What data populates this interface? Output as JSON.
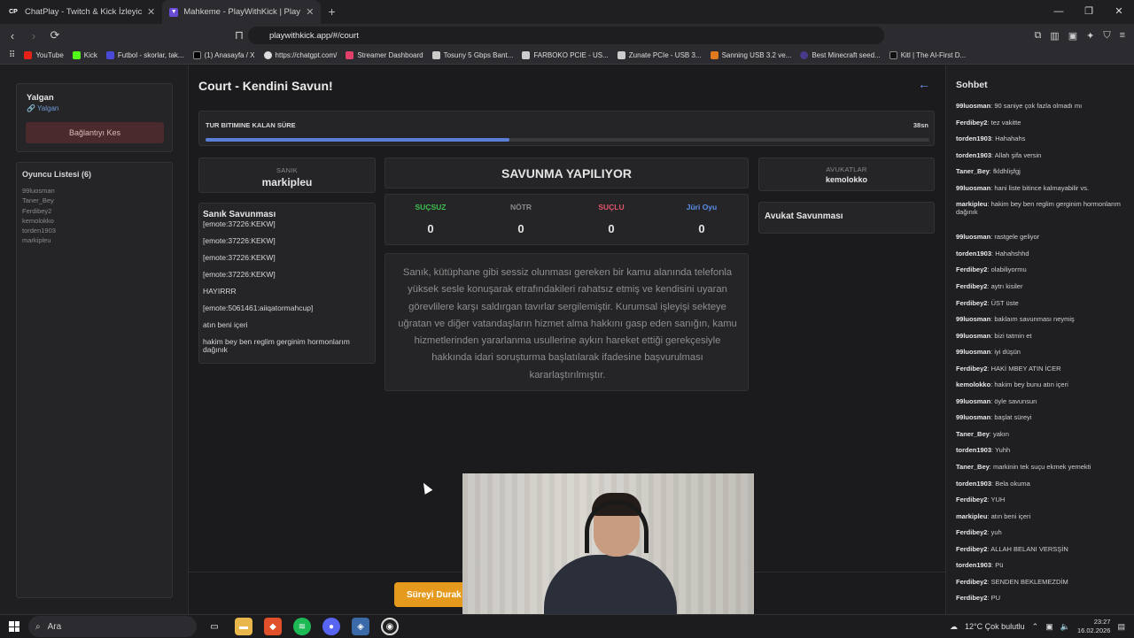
{
  "browser": {
    "tabs": [
      {
        "icon": "CP",
        "title": "ChatPlay - Twitch & Kick İzleyici Etkile",
        "active": false
      },
      {
        "icon": "shield-icon",
        "title": "Mahkeme - PlayWithKick | PlayW",
        "active": true
      }
    ],
    "new_tab": "+",
    "url": "playwithkick.app/#/court",
    "bookmarks": [
      "YouTube",
      "Kick",
      "Futbol - skorlar, tak...",
      "(1) Anasayfa / X",
      "https://chatgpt.com/",
      "Streamer Dashboard",
      "Tosuny 5 Gbps Bant...",
      "FARBOKO PCIE - US...",
      "Zunate PCIe - USB 3...",
      "Sanning USB 3.2 ve...",
      "Best Minecraft seed...",
      "Kitl | The AI-First D..."
    ]
  },
  "left_panel": {
    "user_name": "Yalgan",
    "user_link": "Yalgan",
    "disconnect_label": "Bağlantıyı Kes",
    "player_list_title": "Oyuncu Listesi (6)",
    "players": [
      "99luosman",
      "Taner_Bey",
      "Ferdibey2",
      "kemolokko",
      "torden1903",
      "markipleu"
    ]
  },
  "main": {
    "title": "Court - Kendini Savun!",
    "timer_label": "TUR BITIMINE KALAN SÜRE",
    "timer_value": "38sn",
    "timer_progress": 0.42,
    "defendant_caption": "SANIK",
    "defendant_name": "markipleu",
    "defense_title": "Sanık Savunması",
    "defense_lines": [
      "[emote:37226:KEKW]",
      "[emote:37226:KEKW]",
      "[emote:37226:KEKW]",
      "[emote:37226:KEKW]",
      "HAYIRRR",
      "[emote:5061461:aiiqatormahcup]",
      "atın beni içeri",
      "hakim bey ben reglim gerginim hormonlarım dağınık"
    ],
    "status": "SAVUNMA YAPILIYOR",
    "votes": [
      {
        "label": "SUÇSUZ",
        "value": "0",
        "color": "#3fbf4f"
      },
      {
        "label": "NÖTR",
        "value": "0",
        "color": "#8a8a8a"
      },
      {
        "label": "SUÇLU",
        "value": "0",
        "color": "#e0556a"
      },
      {
        "label": "Jüri Oyu",
        "value": "0",
        "color": "#5c8fe8"
      }
    ],
    "case_text": "Sanık, kütüphane gibi sessiz olunması gereken bir kamu alanında telefonla yüksek sesle konuşarak etrafındakileri rahatsız etmiş ve kendisini uyaran görevlilere karşı saldırgan tavırlar sergilemiştir. Kurumsal işleyişi sekteye uğratan ve diğer vatandaşların hizmet alma hakkını gasp eden sanığın, kamu hizmetlerinden yararlanma usullerine aykırı hareket ettiği gerekçesiyle hakkında idari soruşturma başlatılarak ifadesine başvurulması kararlaştırılmıştır.",
    "lawyers_caption": "AVUKATLAR",
    "lawyer_name": "kemolokko",
    "lawyer_defense_title": "Avukat Savunması",
    "stop_button": "Süreyi Durak"
  },
  "chat": {
    "title": "Sohbet",
    "messages": [
      {
        "user": "99luosman",
        "text": "90 saniye çok fazla olmadı mı"
      },
      {
        "user": "Ferdibey2",
        "text": "tez vakitte"
      },
      {
        "user": "torden1903",
        "text": "Hahahahs"
      },
      {
        "user": "torden1903",
        "text": "Allah şifa versin"
      },
      {
        "user": "Taner_Bey",
        "text": "fkldhlişfgj"
      },
      {
        "user": "99luosman",
        "text": "hani liste bitince kalmayabilir vs."
      },
      {
        "user": "markipleu",
        "text": "hakim bey ben reglim gerginim hormonlarım dağınık"
      },
      {
        "user": "99luosman",
        "text": "rastgele geliyor"
      },
      {
        "user": "torden1903",
        "text": "Hahahshhd"
      },
      {
        "user": "Ferdibey2",
        "text": "olabiliyormu"
      },
      {
        "user": "Ferdibey2",
        "text": "aytrı kisiler"
      },
      {
        "user": "Ferdibey2",
        "text": "ÜST üste"
      },
      {
        "user": "99luosman",
        "text": "baklaım savunması neymiş"
      },
      {
        "user": "99luosman",
        "text": "bizi tatmin et"
      },
      {
        "user": "99luosman",
        "text": "iyi düşün"
      },
      {
        "user": "Ferdibey2",
        "text": "HAKİ MBEY ATIN İCER"
      },
      {
        "user": "kemolokko",
        "text": "hakim bey bunu atın içeri"
      },
      {
        "user": "99luosman",
        "text": "öyle savunsun"
      },
      {
        "user": "99luosman",
        "text": "başlat süreyi"
      },
      {
        "user": "Taner_Bey",
        "text": "yakın"
      },
      {
        "user": "torden1903",
        "text": "Yuhh"
      },
      {
        "user": "Taner_Bey",
        "text": "markinin tek suçu ekmek yemekti"
      },
      {
        "user": "torden1903",
        "text": "Bela okuma"
      },
      {
        "user": "Ferdibey2",
        "text": "YUH"
      },
      {
        "user": "markipleu",
        "text": "atın beni içeri"
      },
      {
        "user": "Ferdibey2",
        "text": "yuh"
      },
      {
        "user": "Ferdibey2",
        "text": "ALLAH BELANI VERSŞİN"
      },
      {
        "user": "torden1903",
        "text": "Pü"
      },
      {
        "user": "Ferdibey2",
        "text": "SENDEN BEKLEMEZDİM"
      },
      {
        "user": "Ferdibey2",
        "text": "PU"
      }
    ]
  },
  "taskbar": {
    "search_placeholder": "Ara",
    "weather": "12°C  Çok bulutlu",
    "time": "23:27",
    "date": "16.02.2026"
  }
}
